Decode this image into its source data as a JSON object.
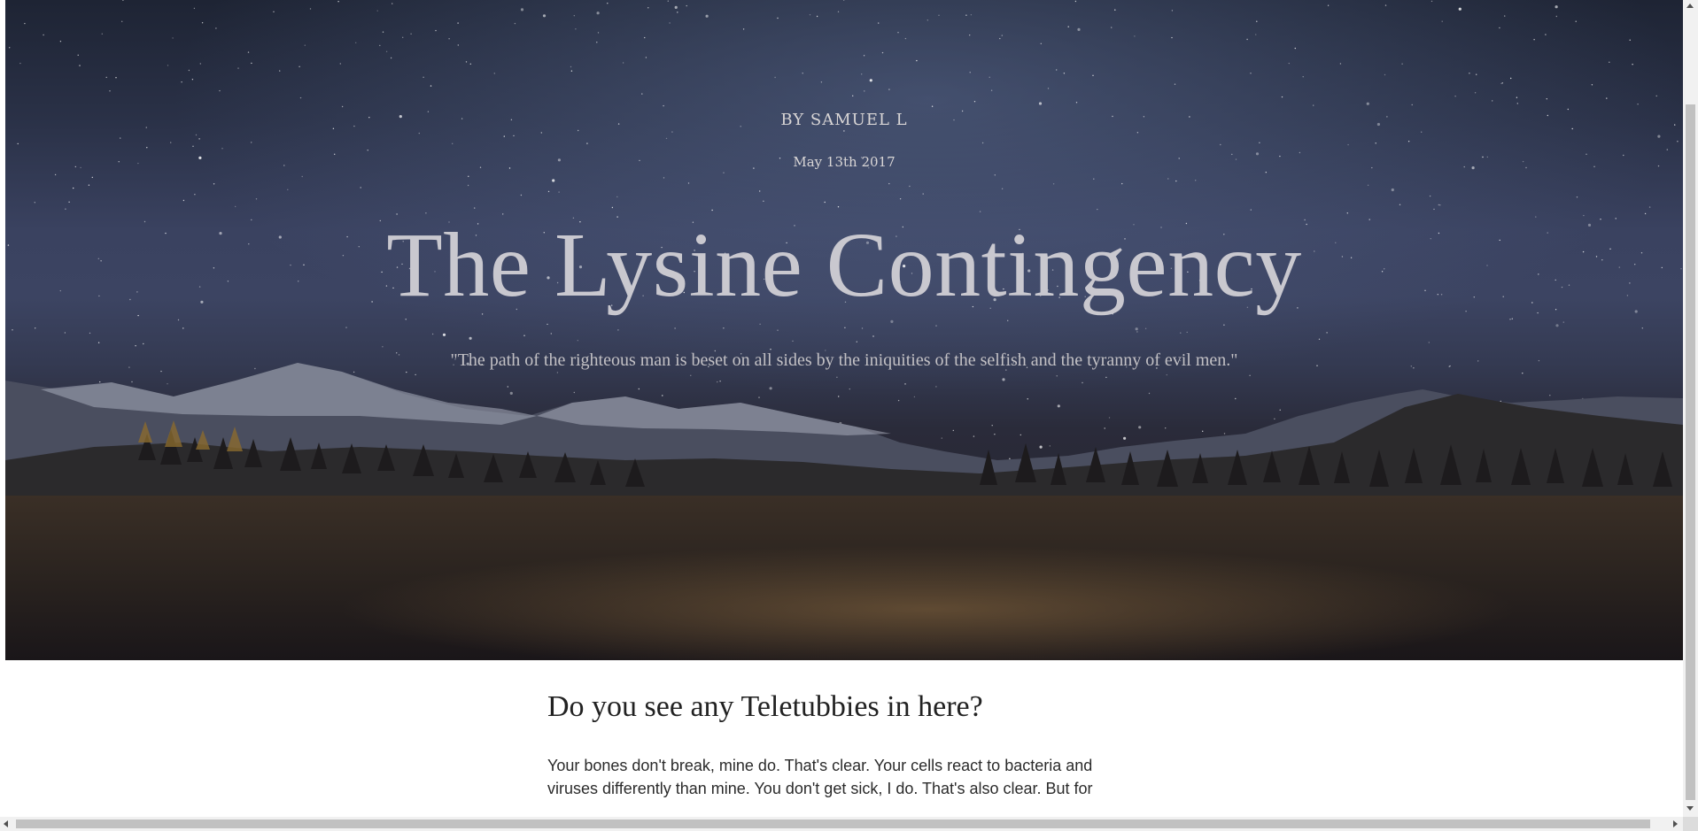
{
  "hero": {
    "byline": "BY SAMUEL L",
    "date": "May 13th 2017",
    "title": "The Lysine Contingency",
    "quote": "\"The path of the righteous man is beset on all sides by the iniquities of the selfish and the tyranny of evil men.\""
  },
  "article": {
    "heading": "Do you see any Teletubbies in here?",
    "body": "Your bones don't break, mine do. That's clear. Your cells react to bacteria and viruses differently than mine. You don't get sick, I do. That's also clear. But for"
  },
  "colors": {
    "hero_text": "#c9c8cf",
    "heading": "#222222",
    "scrollbar_thumb": "#c1c1c1"
  }
}
